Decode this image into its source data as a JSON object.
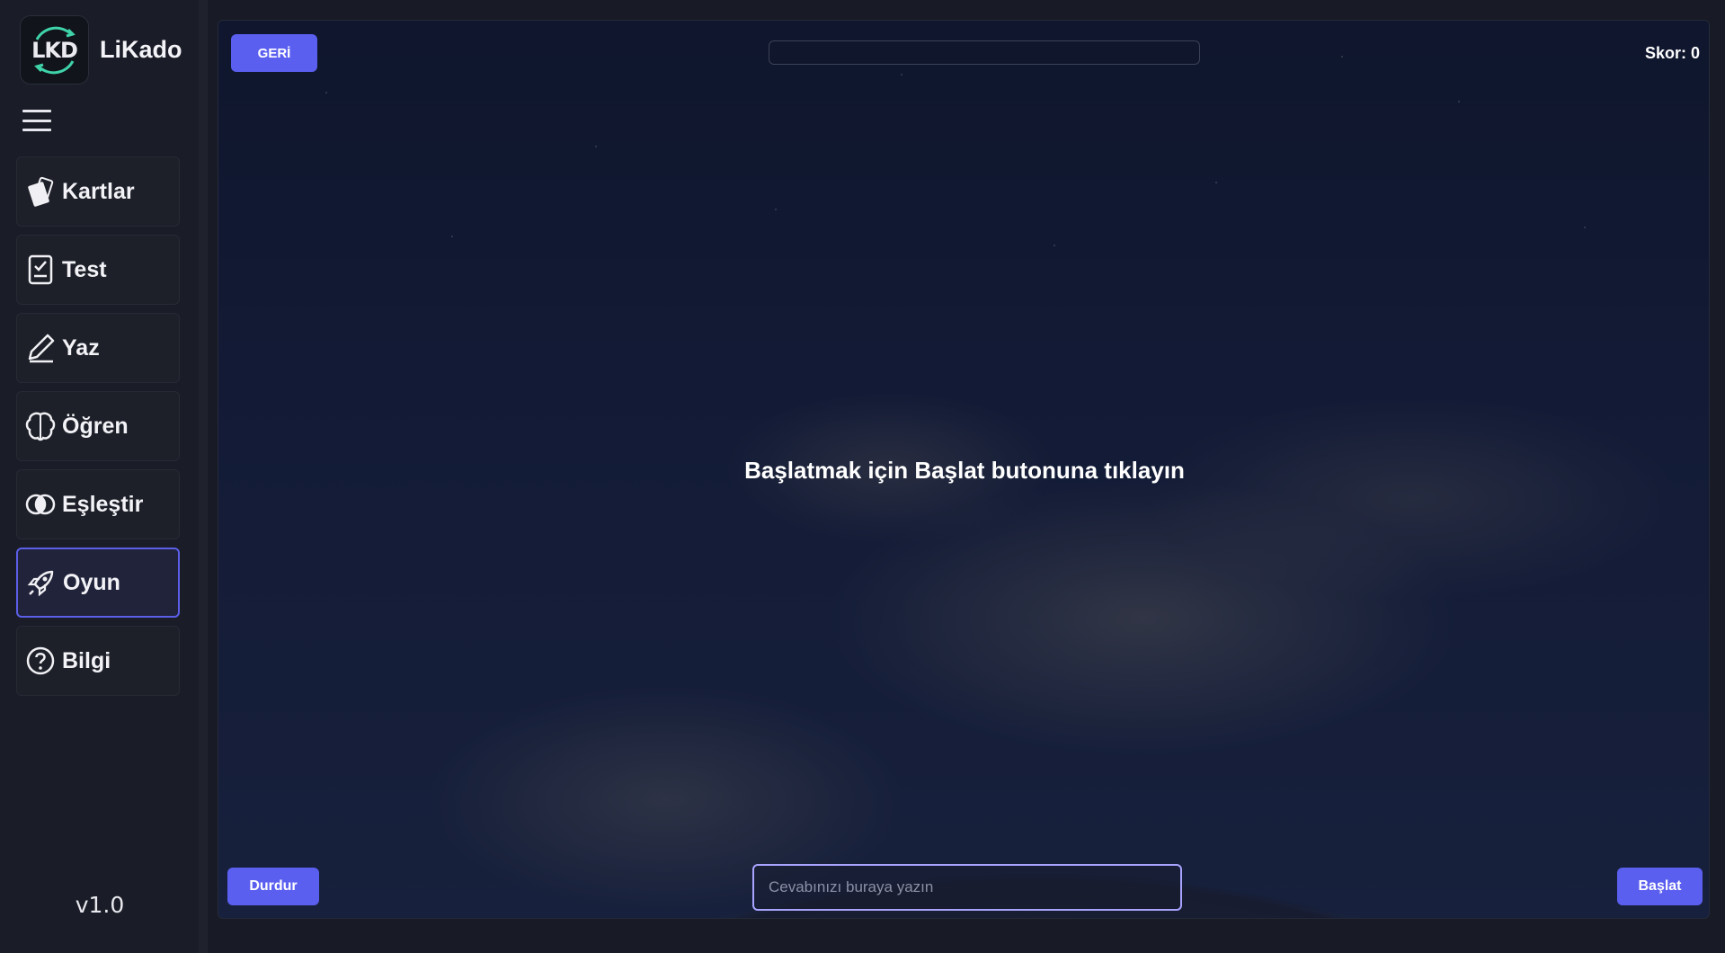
{
  "app": {
    "name": "LiKado",
    "logo_text": "LKD",
    "version": "v1.0"
  },
  "sidebar": {
    "items": [
      {
        "label": "Kartlar",
        "icon": "cards-icon",
        "active": false
      },
      {
        "label": "Test",
        "icon": "clipboard-check-icon",
        "active": false
      },
      {
        "label": "Yaz",
        "icon": "pen-icon",
        "active": false
      },
      {
        "label": "Öğren",
        "icon": "brain-icon",
        "active": false
      },
      {
        "label": "Eşleştir",
        "icon": "match-circles-icon",
        "active": false
      },
      {
        "label": "Oyun",
        "icon": "rocket-icon",
        "active": true
      },
      {
        "label": "Bilgi",
        "icon": "help-circle-icon",
        "active": false
      }
    ]
  },
  "game": {
    "back_label": "GERİ",
    "score_text": "Skor: 0",
    "progress": 0,
    "message": "Başlatmak için Başlat butonuna tıklayın",
    "answer_placeholder": "Cevabınızı buraya yazın",
    "answer_value": "",
    "stop_label": "Durdur",
    "start_label": "Başlat"
  },
  "colors": {
    "accent": "#5b5ff0",
    "active_border": "#5b5fe8",
    "sidebar_bg": "#1a1d27",
    "input_border": "#a9a4ff"
  }
}
